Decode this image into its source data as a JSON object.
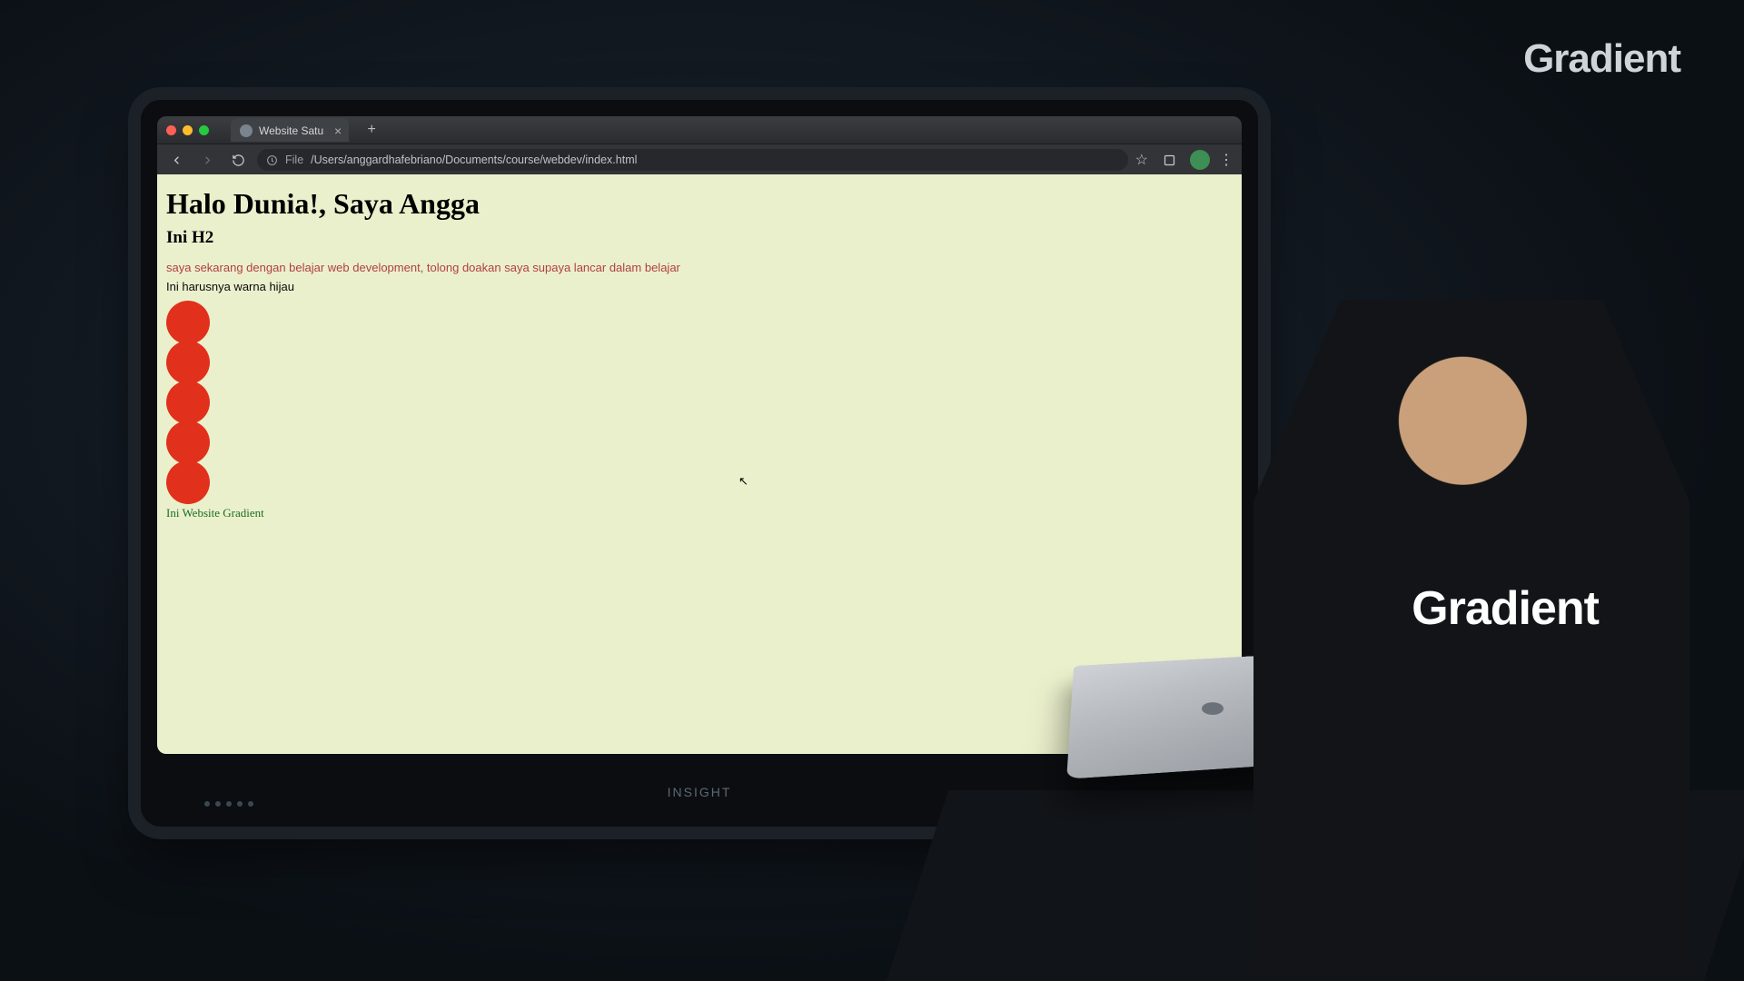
{
  "watermark": "Gradient",
  "tv_brand": "INSIGHT",
  "shirt": "Gradient",
  "browser": {
    "tab_title": "Website Satu",
    "file_label": "File",
    "url": "/Users/anggardhafebriano/Documents/course/webdev/index.html"
  },
  "page": {
    "h1": "Halo Dunia!, Saya Angga",
    "h2": "Ini H2",
    "paragraph": "saya sekarang dengan belajar web development, tolong doakan saya supaya lancar dalam belajar",
    "note": "Ini harusnya warna hijau",
    "footer_link": "Ini Website Gradient",
    "dot_count": 5
  }
}
